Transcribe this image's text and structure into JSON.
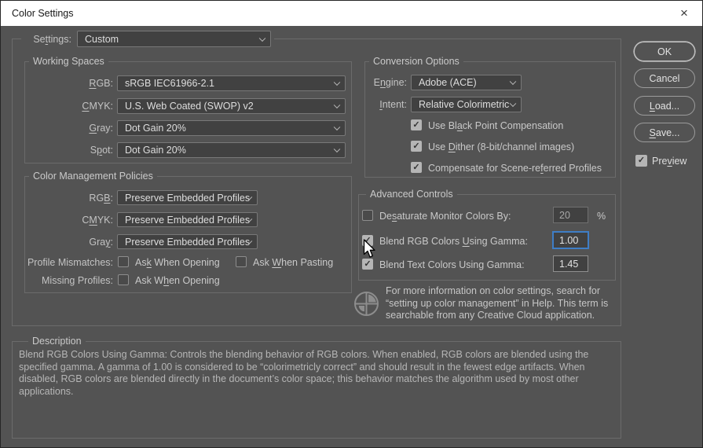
{
  "window": {
    "title": "Color Settings",
    "close_icon": "×"
  },
  "icons": {
    "check": "✓"
  },
  "settings": {
    "label": "Se&ttings:",
    "value": "Custom"
  },
  "working_spaces": {
    "legend": "Working Spaces",
    "rows": [
      {
        "label": "&RGB:",
        "value": "sRGB IEC61966-2.1"
      },
      {
        "label": "&CMYK:",
        "value": "U.S. Web Coated (SWOP) v2"
      },
      {
        "label": "&Gray:",
        "value": "Dot Gain 20%"
      },
      {
        "label": "S&pot:",
        "value": "Dot Gain 20%"
      }
    ]
  },
  "policies": {
    "legend": "Color Management Policies",
    "rows": [
      {
        "label": "RG&B:",
        "value": "Preserve Embedded Profiles"
      },
      {
        "label": "C&MYK:",
        "value": "Preserve Embedded Profiles"
      },
      {
        "label": "Gra&y:",
        "value": "Preserve Embedded Profiles"
      }
    ],
    "mismatch_label": "Profile Mismatches:",
    "mismatch_opt1": "As&k When Opening",
    "mismatch_opt2": "Ask &When Pasting",
    "missing_label": "Missing Profiles:",
    "missing_opt1": "Ask W&hen Opening"
  },
  "conversion": {
    "legend": "Conversion Options",
    "engine_label": "E&ngine:",
    "engine_value": "Adobe (ACE)",
    "intent_label": "&Intent:",
    "intent_value": "Relative Colorimetric",
    "checks": [
      "Use Bl&ack Point Compensation",
      "Use &Dither (8-bit/channel images)",
      "Compensate for Scene-re&ferred Profiles"
    ]
  },
  "advanced": {
    "legend": "Advanced Controls",
    "desaturate_label": "De&saturate Monitor Colors By:",
    "desaturate_value": "20",
    "desaturate_unit": "%",
    "blend_rgb_label": "Blend RGB Colors &Using Gamma:",
    "blend_rgb_value": "1.00",
    "blend_text_label": "Blend Text Colors Using Gamma:",
    "blend_text_value": "1.45"
  },
  "info_text": "For more information on color settings, search for “setting up color management” in Help. This term is searchable from any Creative Cloud application.",
  "description": {
    "legend": "Description",
    "text": "Blend RGB Colors Using Gamma:  Controls the blending behavior of RGB colors.  When enabled, RGB colors are blended using the specified gamma.  A gamma of 1.00 is considered to be “colorimetricly correct” and should result in the fewest edge artifacts.  When disabled, RGB colors are blended directly in the document’s color space; this behavior matches the algorithm used by most other applications."
  },
  "buttons": {
    "ok": "OK",
    "cancel": "Cancel",
    "load": "&Load...",
    "save": "&Save...",
    "preview_label": "Pre&view"
  },
  "colors": {
    "dialog_bg": "#535353",
    "titlebar_bg": "#ffffff",
    "group_border": "#6b6b6b",
    "focus_border": "#3f7ec6"
  }
}
